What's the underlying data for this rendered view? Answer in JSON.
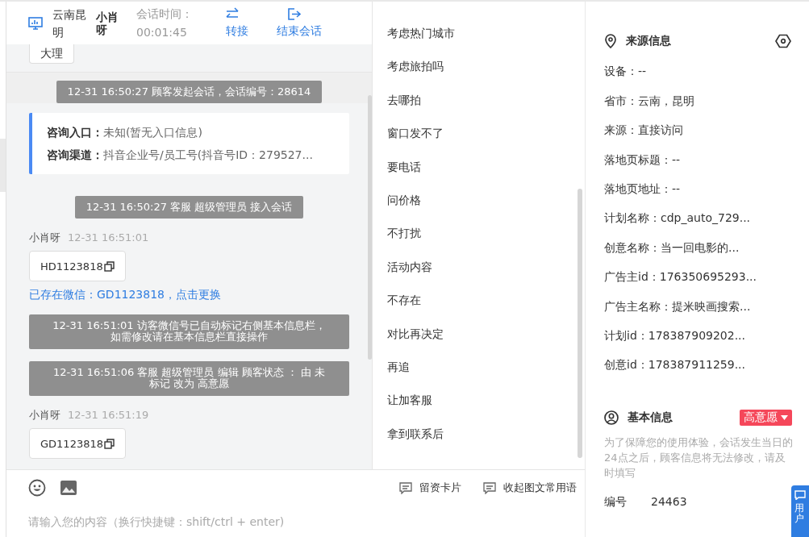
{
  "header": {
    "location": "云南昆明",
    "customer": "小肖呀",
    "timer_label": "会话时间：",
    "timer": "00:01:45",
    "actions": [
      {
        "kind": "transfer",
        "label": "转接"
      },
      {
        "kind": "end",
        "label": "结束会话"
      }
    ]
  },
  "messages": [
    {
      "kind": "bubble",
      "text": "大理"
    },
    {
      "kind": "system",
      "text": "12-31 16:50:27 顾客发起会话，会话编号：28614"
    },
    {
      "kind": "info",
      "rows": [
        {
          "label": "咨询入口：",
          "value": "未知(暂无入口信息)"
        },
        {
          "label": "咨询渠道：",
          "value": "抖音企业号/员工号(抖音号ID：279527..."
        }
      ]
    },
    {
      "kind": "system",
      "text": "12-31 16:50:27 客服 超级管理员 接入会话"
    },
    {
      "kind": "sender",
      "name": "小肖呀",
      "time": "12-31 16:51:01"
    },
    {
      "kind": "bubble",
      "text": "HD1123818",
      "copy": true
    },
    {
      "kind": "link",
      "text": "已存在微信：GD1123818，点击更换"
    },
    {
      "kind": "notice",
      "text": "12-31 16:51:01 访客微信号已自动标记右侧基本信息栏，如需修改请在基本信息栏直接操作"
    },
    {
      "kind": "notice",
      "text": "12-31 16:51:06 客服 超级管理员 编辑 顾客状态 ： 由 未标记 改为 高意愿"
    },
    {
      "kind": "sender",
      "name": "小肖呀",
      "time": "12-31 16:51:19"
    },
    {
      "kind": "bubble",
      "text": "GD1123818",
      "copy": true
    }
  ],
  "quick_replies": [
    "考虑热门城市",
    "考虑旅拍吗",
    "去哪拍",
    "窗口发不了",
    "要电话",
    "问价格",
    "不打扰",
    "活动内容",
    "不存在",
    "对比再决定",
    "再追",
    "让加客服",
    "拿到联系后"
  ],
  "composer": {
    "placeholder": "请输入您的内容（换行快捷键：shift/ctrl + enter)",
    "buttons": [
      "留资卡片",
      "收起图文常用语"
    ]
  },
  "source_info": {
    "title": "来源信息",
    "fields": [
      "设备：--",
      "省市：云南，昆明",
      "来源：直接访问",
      "落地页标题：--",
      "落地页地址：--",
      "计划名称：cdp_auto_729...",
      "创意名称：当一回电影的...",
      "广告主id：176350695293...",
      "广告主名称：提米映画搜索...",
      "计划id：178387909202...",
      "创意id：178387911259..."
    ]
  },
  "basic_info": {
    "title": "基本信息",
    "status": {
      "label": "高意愿",
      "color": "#f5475a"
    },
    "note": "为了保障您的使用体验，会话发生当日的24点之后，顾客信息将无法修改，请及时填写",
    "fields": [
      {
        "label": "编号",
        "value": "24463"
      }
    ]
  },
  "float_tab": {
    "label": "用户"
  }
}
